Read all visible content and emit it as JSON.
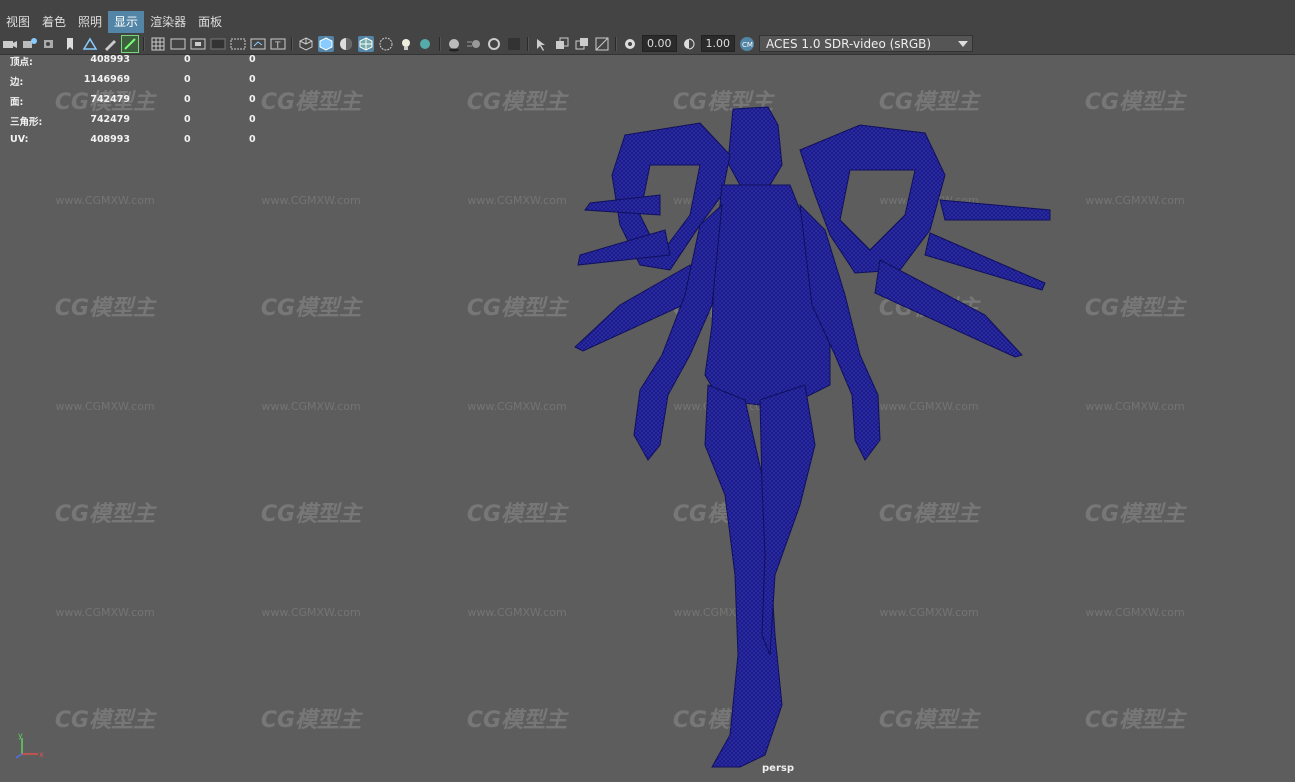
{
  "menu": {
    "items": [
      "视图",
      "着色",
      "照明",
      "显示",
      "渲染器",
      "面板"
    ],
    "active_index": 3
  },
  "toolbar": {
    "exposure_value": "0.00",
    "gamma_value": "1.00",
    "color_space": "ACES 1.0 SDR-video (sRGB)"
  },
  "hud": {
    "rows": [
      {
        "label": "顶点:",
        "v1": "408993",
        "v2": "0",
        "v3": "0"
      },
      {
        "label": "边:",
        "v1": "1146969",
        "v2": "0",
        "v3": "0"
      },
      {
        "label": "面:",
        "v1": "742479",
        "v2": "0",
        "v3": "0"
      },
      {
        "label": "三角形:",
        "v1": "742479",
        "v2": "0",
        "v3": "0"
      },
      {
        "label": "UV:",
        "v1": "408993",
        "v2": "0",
        "v3": "0"
      }
    ]
  },
  "watermark": {
    "logo": "CG模型主",
    "url": "www.CGMXW.com"
  },
  "viewport": {
    "camera": "persp",
    "axis_y": "y",
    "axis_x": "x",
    "wire_color": "#1b1b8a"
  },
  "colors": {
    "accent": "#5285a6",
    "mesh": "#1b1b8a",
    "background": "#5d5d5d"
  }
}
